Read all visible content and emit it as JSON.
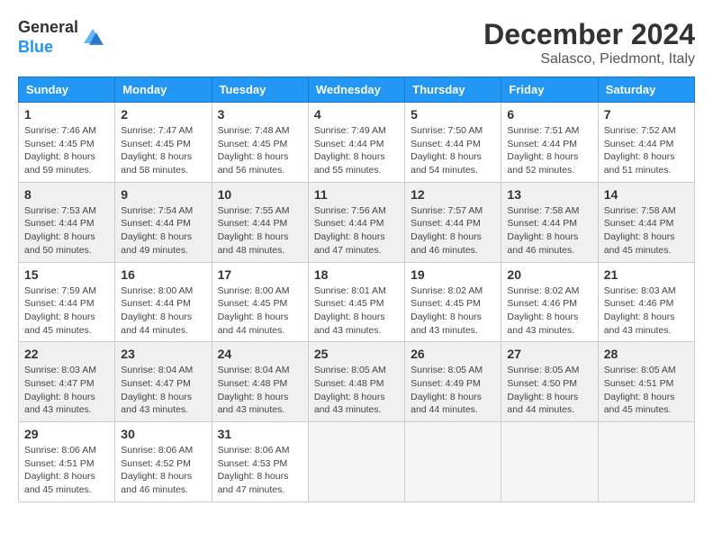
{
  "header": {
    "logo_general": "General",
    "logo_blue": "Blue",
    "month_title": "December 2024",
    "location": "Salasco, Piedmont, Italy"
  },
  "calendar": {
    "weekdays": [
      "Sunday",
      "Monday",
      "Tuesday",
      "Wednesday",
      "Thursday",
      "Friday",
      "Saturday"
    ],
    "weeks": [
      [
        {
          "day": "1",
          "sunrise": "7:46 AM",
          "sunset": "4:45 PM",
          "daylight": "8 hours and 59 minutes."
        },
        {
          "day": "2",
          "sunrise": "7:47 AM",
          "sunset": "4:45 PM",
          "daylight": "8 hours and 58 minutes."
        },
        {
          "day": "3",
          "sunrise": "7:48 AM",
          "sunset": "4:45 PM",
          "daylight": "8 hours and 56 minutes."
        },
        {
          "day": "4",
          "sunrise": "7:49 AM",
          "sunset": "4:44 PM",
          "daylight": "8 hours and 55 minutes."
        },
        {
          "day": "5",
          "sunrise": "7:50 AM",
          "sunset": "4:44 PM",
          "daylight": "8 hours and 54 minutes."
        },
        {
          "day": "6",
          "sunrise": "7:51 AM",
          "sunset": "4:44 PM",
          "daylight": "8 hours and 52 minutes."
        },
        {
          "day": "7",
          "sunrise": "7:52 AM",
          "sunset": "4:44 PM",
          "daylight": "8 hours and 51 minutes."
        }
      ],
      [
        {
          "day": "8",
          "sunrise": "7:53 AM",
          "sunset": "4:44 PM",
          "daylight": "8 hours and 50 minutes."
        },
        {
          "day": "9",
          "sunrise": "7:54 AM",
          "sunset": "4:44 PM",
          "daylight": "8 hours and 49 minutes."
        },
        {
          "day": "10",
          "sunrise": "7:55 AM",
          "sunset": "4:44 PM",
          "daylight": "8 hours and 48 minutes."
        },
        {
          "day": "11",
          "sunrise": "7:56 AM",
          "sunset": "4:44 PM",
          "daylight": "8 hours and 47 minutes."
        },
        {
          "day": "12",
          "sunrise": "7:57 AM",
          "sunset": "4:44 PM",
          "daylight": "8 hours and 46 minutes."
        },
        {
          "day": "13",
          "sunrise": "7:58 AM",
          "sunset": "4:44 PM",
          "daylight": "8 hours and 46 minutes."
        },
        {
          "day": "14",
          "sunrise": "7:58 AM",
          "sunset": "4:44 PM",
          "daylight": "8 hours and 45 minutes."
        }
      ],
      [
        {
          "day": "15",
          "sunrise": "7:59 AM",
          "sunset": "4:44 PM",
          "daylight": "8 hours and 45 minutes."
        },
        {
          "day": "16",
          "sunrise": "8:00 AM",
          "sunset": "4:44 PM",
          "daylight": "8 hours and 44 minutes."
        },
        {
          "day": "17",
          "sunrise": "8:00 AM",
          "sunset": "4:45 PM",
          "daylight": "8 hours and 44 minutes."
        },
        {
          "day": "18",
          "sunrise": "8:01 AM",
          "sunset": "4:45 PM",
          "daylight": "8 hours and 43 minutes."
        },
        {
          "day": "19",
          "sunrise": "8:02 AM",
          "sunset": "4:45 PM",
          "daylight": "8 hours and 43 minutes."
        },
        {
          "day": "20",
          "sunrise": "8:02 AM",
          "sunset": "4:46 PM",
          "daylight": "8 hours and 43 minutes."
        },
        {
          "day": "21",
          "sunrise": "8:03 AM",
          "sunset": "4:46 PM",
          "daylight": "8 hours and 43 minutes."
        }
      ],
      [
        {
          "day": "22",
          "sunrise": "8:03 AM",
          "sunset": "4:47 PM",
          "daylight": "8 hours and 43 minutes."
        },
        {
          "day": "23",
          "sunrise": "8:04 AM",
          "sunset": "4:47 PM",
          "daylight": "8 hours and 43 minutes."
        },
        {
          "day": "24",
          "sunrise": "8:04 AM",
          "sunset": "4:48 PM",
          "daylight": "8 hours and 43 minutes."
        },
        {
          "day": "25",
          "sunrise": "8:05 AM",
          "sunset": "4:48 PM",
          "daylight": "8 hours and 43 minutes."
        },
        {
          "day": "26",
          "sunrise": "8:05 AM",
          "sunset": "4:49 PM",
          "daylight": "8 hours and 44 minutes."
        },
        {
          "day": "27",
          "sunrise": "8:05 AM",
          "sunset": "4:50 PM",
          "daylight": "8 hours and 44 minutes."
        },
        {
          "day": "28",
          "sunrise": "8:05 AM",
          "sunset": "4:51 PM",
          "daylight": "8 hours and 45 minutes."
        }
      ],
      [
        {
          "day": "29",
          "sunrise": "8:06 AM",
          "sunset": "4:51 PM",
          "daylight": "8 hours and 45 minutes."
        },
        {
          "day": "30",
          "sunrise": "8:06 AM",
          "sunset": "4:52 PM",
          "daylight": "8 hours and 46 minutes."
        },
        {
          "day": "31",
          "sunrise": "8:06 AM",
          "sunset": "4:53 PM",
          "daylight": "8 hours and 47 minutes."
        },
        null,
        null,
        null,
        null
      ]
    ]
  }
}
